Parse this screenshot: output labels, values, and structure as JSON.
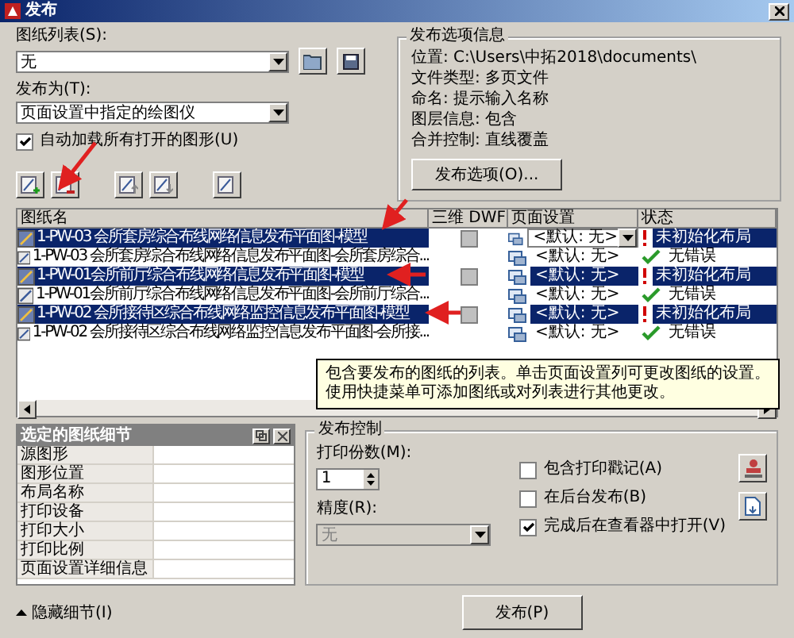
{
  "window": {
    "title": "发布"
  },
  "sheet_list": {
    "label": "图纸列表(S):",
    "value": "无"
  },
  "publish_to": {
    "label": "发布为(T):",
    "value": "页面设置中指定的绘图仪"
  },
  "auto_load": {
    "label": "自动加载所有打开的图形(U)",
    "checked": true
  },
  "options_info": {
    "title": "发布选项信息",
    "lines": [
      "位置: C:\\Users\\中拓2018\\documents\\",
      "文件类型: 多页文件",
      "命名: 提示输入名称",
      "图层信息: 包含",
      "合并控制: 直线覆盖"
    ],
    "button": "发布选项(O)..."
  },
  "table": {
    "columns": [
      "图纸名",
      "三维 DWF",
      "页面设置",
      "状态"
    ],
    "rows": [
      {
        "name": "1-PW-03 会所套房综合布线网络信息发布平面图-模型",
        "kind": "model",
        "selected": true,
        "dwf_checked": false,
        "page_setup": "<默认: 无>",
        "dropdown": true,
        "status": "未初始化布局",
        "error": true
      },
      {
        "name": "1-PW-03 会所套房综合布线网络信息发布平面图-会所套房综合...",
        "kind": "layout",
        "selected": false,
        "page_setup": "<默认: 无>",
        "dropdown": false,
        "status": "无错误",
        "error": false
      },
      {
        "name": "1-PW-01会所前厅综合布线网络信息发布平面图-模型",
        "kind": "model",
        "selected": true,
        "dwf_checked": false,
        "page_setup": "<默认: 无>",
        "dropdown": false,
        "status": "未初始化布局",
        "error": true
      },
      {
        "name": "1-PW-01会所前厅综合布线网络信息发布平面图-会所前厅综合...",
        "kind": "layout",
        "selected": false,
        "page_setup": "<默认: 无>",
        "dropdown": false,
        "status": "无错误",
        "error": false
      },
      {
        "name": "1-PW-02 会所接待区综合布线网络监控信息发布平面图-模型",
        "kind": "model",
        "selected": true,
        "dwf_checked": false,
        "page_setup": "<默认: 无>",
        "dropdown": false,
        "status": "未初始化布局",
        "error": true
      },
      {
        "name": "1-PW-02 会所接待区综合布线网络监控信息发布平面图-会所接...",
        "kind": "layout",
        "selected": false,
        "page_setup": "<默认: 无>",
        "dropdown": false,
        "status": "无错误",
        "error": false
      }
    ]
  },
  "tooltip": {
    "lines": [
      "包含要发布的图纸的列表。单击页面设置列可更改图纸的设置。",
      "使用快捷菜单可添加图纸或对列表进行其他更改。"
    ]
  },
  "details": {
    "title": "选定的图纸细节",
    "rows": [
      "源图形",
      "图形位置",
      "布局名称",
      "打印设备",
      "打印大小",
      "打印比例",
      "页面设置详细信息"
    ]
  },
  "publish_control": {
    "title": "发布控制",
    "copies": {
      "label": "打印份数(M):",
      "value": "1"
    },
    "precision": {
      "label": "精度(R):",
      "value": "无",
      "disabled": true
    },
    "options": [
      {
        "label": "包含打印戳记(A)",
        "checked": false
      },
      {
        "label": "在后台发布(B)",
        "checked": false
      },
      {
        "label": "完成后在查看器中打开(V)",
        "checked": true
      }
    ]
  },
  "footer": {
    "toggle": "隐藏细节(I)",
    "publish_button": "发布(P)"
  }
}
